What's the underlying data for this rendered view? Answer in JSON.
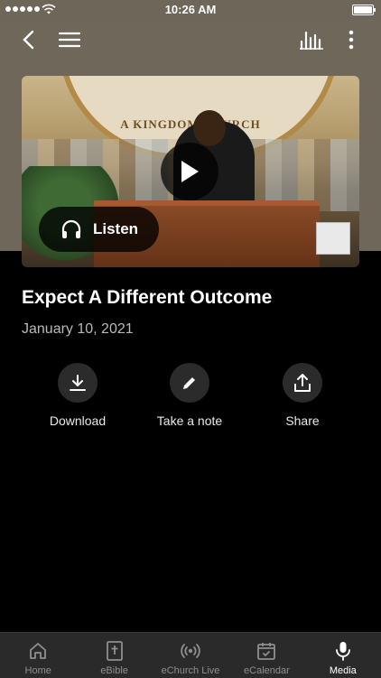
{
  "status_bar": {
    "time": "10:26 AM"
  },
  "media": {
    "title": "Expect A Different Outcome",
    "date": "January 10, 2021",
    "listen_label": "Listen",
    "thumbnail_banner_text": "A KINGDOM CHURCH"
  },
  "actions": [
    {
      "label": "Download",
      "icon": "download-icon"
    },
    {
      "label": "Take a note",
      "icon": "pencil-icon"
    },
    {
      "label": "Share",
      "icon": "share-icon"
    }
  ],
  "tabs": [
    {
      "label": "Home",
      "icon": "home-icon",
      "active": false
    },
    {
      "label": "eBible",
      "icon": "bible-icon",
      "active": false
    },
    {
      "label": "eChurch Live",
      "icon": "broadcast-icon",
      "active": false
    },
    {
      "label": "eCalendar",
      "icon": "calendar-icon",
      "active": false
    },
    {
      "label": "Media",
      "icon": "microphone-icon",
      "active": true
    }
  ],
  "colors": {
    "header_bg": "#6f6759",
    "background": "#000000",
    "tabbar_bg": "#2a2a2a",
    "active_tab": "#ffffff",
    "inactive_tab": "#8f8f8f"
  }
}
